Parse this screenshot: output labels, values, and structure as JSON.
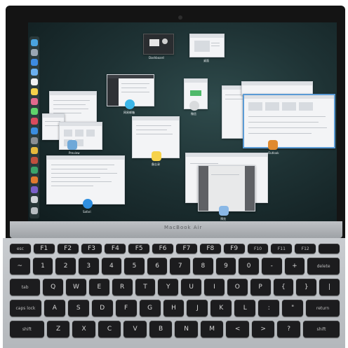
{
  "screen": {
    "spaces": [
      {
        "id": "dashboard",
        "label": "Dashboard"
      },
      {
        "id": "desktop",
        "label": "桌面"
      }
    ],
    "windows": [
      {
        "id": "preview",
        "label": "Preview"
      },
      {
        "id": "app-window-2",
        "label": "网易邮箱"
      },
      {
        "id": "app-window-3",
        "label": "微信"
      },
      {
        "id": "app-window-4",
        "label": "备忘录"
      },
      {
        "id": "safari",
        "label": "Safari"
      },
      {
        "id": "app-window-6",
        "label": "预览"
      },
      {
        "id": "outlook",
        "label": "Outlook"
      }
    ]
  },
  "laptop": {
    "brand": "MacBook Air"
  },
  "keyboard": {
    "rows": [
      [
        "esc",
        "F1",
        "F2",
        "F3",
        "F4",
        "F5",
        "F6",
        "F7",
        "F8",
        "F9",
        "F10",
        "F11",
        "F12",
        ""
      ],
      [
        "~",
        "1",
        "2",
        "3",
        "4",
        "5",
        "6",
        "7",
        "8",
        "9",
        "0",
        "-",
        "+",
        "delete"
      ],
      [
        "tab",
        "Q",
        "W",
        "E",
        "R",
        "T",
        "Y",
        "U",
        "I",
        "O",
        "P",
        "{",
        "}",
        "|"
      ],
      [
        "caps lock",
        "A",
        "S",
        "D",
        "F",
        "G",
        "H",
        "J",
        "K",
        "L",
        ":",
        "\"",
        "return"
      ],
      [
        "shift",
        "Z",
        "X",
        "C",
        "V",
        "B",
        "N",
        "M",
        "<",
        ">",
        "?",
        "shift"
      ]
    ]
  },
  "colors": {
    "screen_bg": "#1e3234",
    "selected_window": "#5b9bd5",
    "key": "#1c1c1e"
  }
}
